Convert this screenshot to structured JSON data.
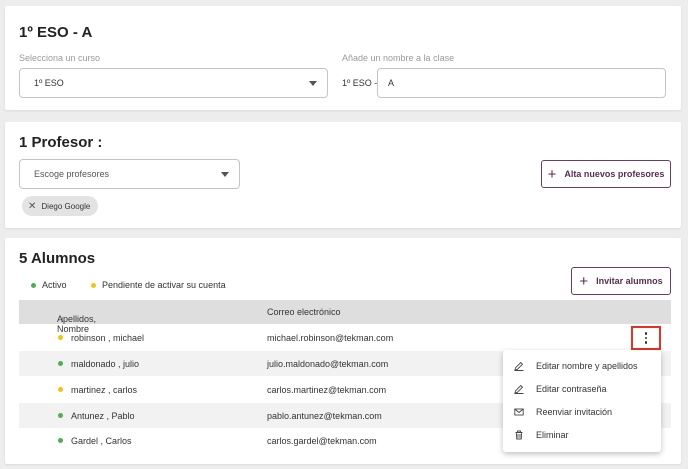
{
  "class_section": {
    "title": "1º ESO - A",
    "course_label": "Selecciona un curso",
    "course_value": "1º ESO",
    "name_label": "Añade un nombre a la clase",
    "name_prefix": "1º ESO -",
    "name_value": "A"
  },
  "teachers_section": {
    "title": "1 Profesor :",
    "select_placeholder": "Escoge profesores",
    "add_button": "Alta nuevos profesores",
    "chips": [
      "Diego Google"
    ]
  },
  "students_section": {
    "title": "5 Alumnos",
    "legend_active": "Activo",
    "legend_pending": "Pendiente de activar su cuenta",
    "invite_button": "Invitar alumnos",
    "col_name": "Apellidos, Nombre",
    "col_email": "Correo electrónico",
    "rows": [
      {
        "name": "robinson , michael",
        "email": "michael.robinson@tekman.com",
        "status": "pending"
      },
      {
        "name": "maldonado , julio",
        "email": "julio.maldonado@tekman.com",
        "status": "active"
      },
      {
        "name": "martinez , carlos",
        "email": "carlos.martinez@tekman.com",
        "status": "pending"
      },
      {
        "name": "Antunez , Pablo",
        "email": "pablo.antunez@tekman.com",
        "status": "active"
      },
      {
        "name": "Gardel , Carlos",
        "email": "carlos.gardel@tekman.com",
        "status": "active"
      }
    ]
  },
  "context_menu": {
    "items": [
      "Editar nombre y apellidos",
      "Editar contraseña",
      "Reenviar invitación",
      "Eliminar"
    ]
  },
  "colors": {
    "active": "#4caf50",
    "pending": "#f2c40f",
    "brand": "#5a2d54",
    "highlight": "#e53323"
  },
  "icons": {
    "sort": "arrow-down-icon",
    "row_menu": "more-vert-icon",
    "menu": [
      "pencil-icon",
      "pencil-icon",
      "envelope-icon",
      "trash-icon"
    ]
  }
}
